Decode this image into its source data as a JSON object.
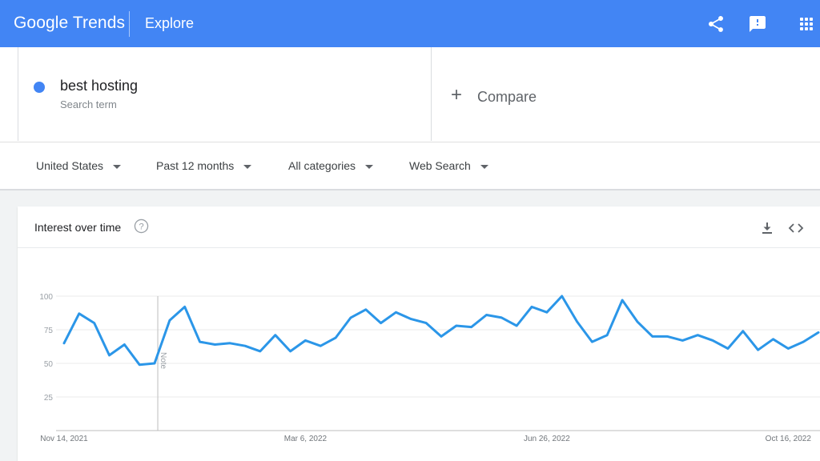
{
  "header": {
    "logo_google": "Google",
    "logo_trends": "Trends",
    "page_title": "Explore",
    "icons": [
      "share-icon",
      "feedback-icon",
      "apps-grid-icon"
    ],
    "brand_color": "#4285f4"
  },
  "term": {
    "name": "best hosting",
    "sub": "Search term",
    "color": "#4285f4"
  },
  "compare": {
    "label": "Compare",
    "icon": "plus-icon"
  },
  "filters": [
    {
      "label": "United States"
    },
    {
      "label": "Past 12 months"
    },
    {
      "label": "All categories"
    },
    {
      "label": "Web Search"
    }
  ],
  "card": {
    "title": "Interest over time",
    "icons": [
      "help-icon",
      "download-icon",
      "embed-icon"
    ]
  },
  "chart_data": {
    "type": "line",
    "series": [
      {
        "color": "#2b96e8",
        "values": [
          65,
          87,
          80,
          56,
          64,
          49,
          50,
          82,
          92,
          66,
          64,
          65,
          63,
          59,
          71,
          59,
          67,
          63,
          69,
          84,
          90,
          80,
          88,
          83,
          80,
          70,
          78,
          77,
          86,
          84,
          78,
          92,
          88,
          100,
          81,
          66,
          71,
          97,
          81,
          70,
          70,
          67,
          71,
          67,
          61,
          74,
          60,
          68,
          61,
          66,
          73
        ]
      }
    ],
    "x_tick_labels": [
      {
        "label": "Nov 14, 2021",
        "index": 0
      },
      {
        "label": "Mar 6, 2022",
        "index": 16
      },
      {
        "label": "Jun 26, 2022",
        "index": 32
      },
      {
        "label": "Oct 16, 2022",
        "index": 48
      }
    ],
    "y_ticks": [
      25,
      50,
      75,
      100
    ],
    "ylim": [
      0,
      100
    ],
    "annotation": {
      "label": "Note",
      "index": 6
    },
    "grid": true
  }
}
